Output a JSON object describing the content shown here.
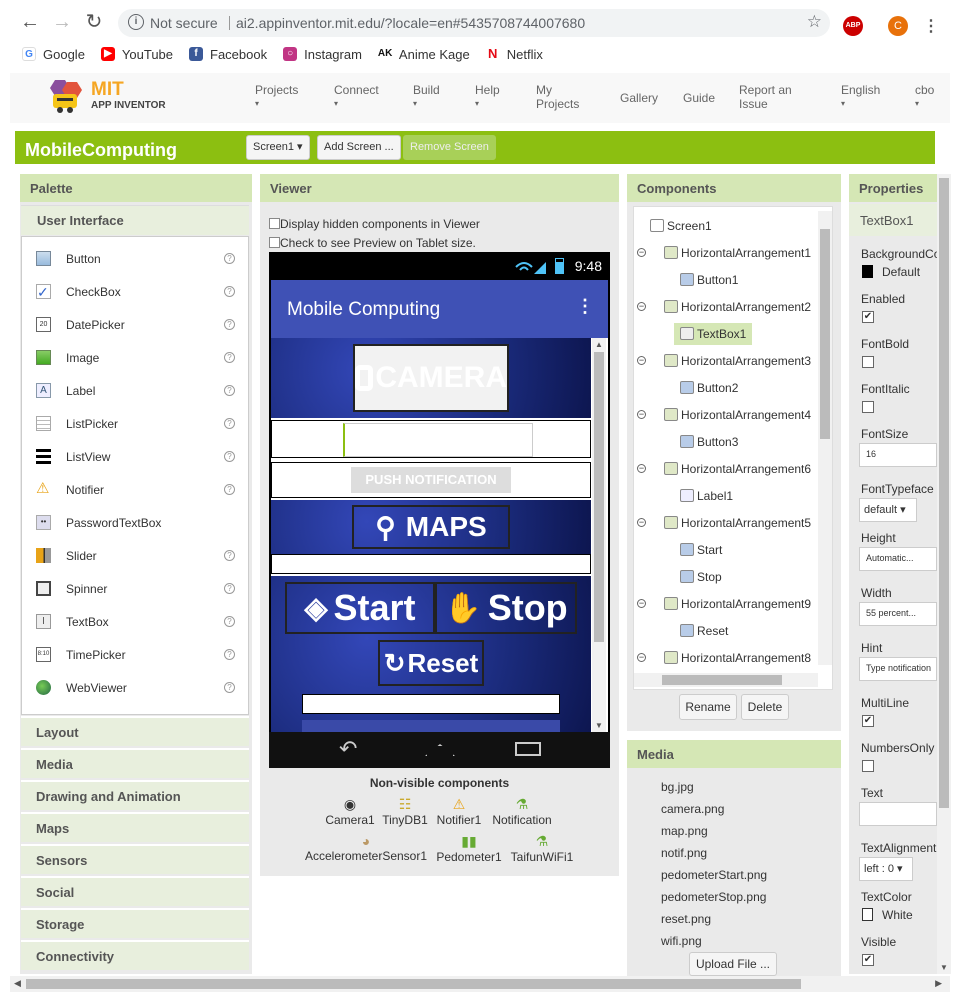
{
  "browser": {
    "security_label": "Not secure",
    "url": "ai2.appinventor.mit.edu/?locale=en#5435708744007680",
    "abp_label": "ABP",
    "profile_initial": "C",
    "bookmarks": [
      "Google",
      "YouTube",
      "Facebook",
      "Instagram",
      "Anime Kage",
      "Netflix"
    ]
  },
  "header": {
    "logo_mit": "MIT",
    "logo_sub": "APP INVENTOR",
    "nav": [
      {
        "label": "Projects",
        "dropdown": true
      },
      {
        "label": "Connect",
        "dropdown": true
      },
      {
        "label": "Build",
        "dropdown": true
      },
      {
        "label": "Help",
        "dropdown": true
      },
      {
        "label": "My Projects",
        "dropdown": false
      },
      {
        "label": "Gallery",
        "dropdown": false
      },
      {
        "label": "Guide",
        "dropdown": false
      },
      {
        "label": "Report an Issue",
        "dropdown": false
      },
      {
        "label": "English",
        "dropdown": true
      },
      {
        "label": "cbo",
        "dropdown": true
      }
    ]
  },
  "project": {
    "name": "MobileComputing",
    "screen_select": "Screen1 ▾",
    "add_screen": "Add Screen ...",
    "remove_screen": "Remove Screen"
  },
  "palette": {
    "title": "Palette",
    "section": "User Interface",
    "items": [
      "Button",
      "CheckBox",
      "DatePicker",
      "Image",
      "Label",
      "ListPicker",
      "ListView",
      "Notifier",
      "PasswordTextBox",
      "Slider",
      "Spinner",
      "TextBox",
      "TimePicker",
      "WebViewer"
    ],
    "help_glyph": "?",
    "categories": [
      "Layout",
      "Media",
      "Drawing and Animation",
      "Maps",
      "Sensors",
      "Social",
      "Storage",
      "Connectivity"
    ]
  },
  "viewer": {
    "title": "Viewer",
    "opt_hidden": "Display hidden components in Viewer",
    "opt_tablet": "Check to see Preview on Tablet size.",
    "phone_time": "9:48",
    "app_title": "Mobile Computing",
    "menu_glyph": "⋮",
    "camera_label": "CAMERA",
    "push_label": "PUSH NOTIFICATION",
    "maps_label": "MAPS",
    "start_label": "Start",
    "stop_label": "Stop",
    "reset_label": "Reset",
    "nonvisible_title": "Non-visible components",
    "nonvisible": [
      "Camera1",
      "TinyDB1",
      "Notifier1",
      "Notification",
      "AccelerometerSensor1",
      "Pedometer1",
      "TaifunWiFi1"
    ]
  },
  "components": {
    "title": "Components",
    "tree": [
      "Screen1",
      "HorizontalArrangement1",
      "Button1",
      "HorizontalArrangement2",
      "TextBox1",
      "HorizontalArrangement3",
      "Button2",
      "HorizontalArrangement4",
      "Button3",
      "HorizontalArrangement6",
      "Label1",
      "HorizontalArrangement5",
      "Start",
      "Stop",
      "HorizontalArrangement9",
      "Reset",
      "HorizontalArrangement8"
    ],
    "collapse_glyph": "−",
    "rename": "Rename",
    "delete": "Delete"
  },
  "media": {
    "title": "Media",
    "files": [
      "bg.jpg",
      "camera.png",
      "map.png",
      "notif.png",
      "pedometerStart.png",
      "pedometerStop.png",
      "reset.png",
      "wifi.png"
    ],
    "upload": "Upload File ..."
  },
  "properties": {
    "title": "Properties",
    "component": "TextBox1",
    "bg_label": "BackgroundColor",
    "bg_value": "Default",
    "enabled_label": "Enabled",
    "fontbold_label": "FontBold",
    "fontitalic_label": "FontItalic",
    "fontsize_label": "FontSize",
    "fontsize_value": "16",
    "typeface_label": "FontTypeface",
    "typeface_value": "default ▾",
    "height_label": "Height",
    "height_value": "Automatic...",
    "width_label": "Width",
    "width_value": "55 percent...",
    "hint_label": "Hint",
    "hint_value": "Type notification",
    "multiline_label": "MultiLine",
    "numbersonly_label": "NumbersOnly",
    "text_label": "Text",
    "text_value": "",
    "align_label": "TextAlignment",
    "align_value": "left : 0 ▾",
    "textcolor_label": "TextColor",
    "textcolor_value": "White",
    "visible_label": "Visible",
    "check_glyph": "✔"
  }
}
